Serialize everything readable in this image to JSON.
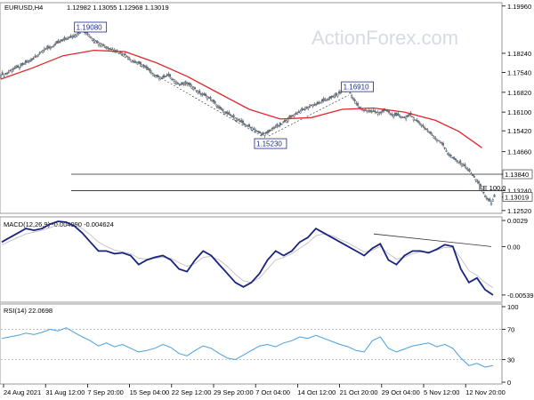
{
  "chart_data": [
    {
      "type": "candlestick",
      "symbol_header": "EURUSD,H4",
      "ohlc_header": "1.12982 1.13055 1.12968 1.13019",
      "watermark": "ActionForex.com",
      "ylim": [
        1.1245,
        1.2005
      ],
      "y_ticks": [
        "1.19960",
        "1.18240",
        "1.17540",
        "1.16820",
        "1.16100",
        "1.15420",
        "1.14660",
        "1.13840",
        "1.13240",
        "1.13019",
        "1.12520"
      ],
      "x_ticks": [
        "24 Aug 2021",
        "31 Aug 12:00",
        "7 Sep 20:00",
        "15 Sep 04:00",
        "22 Sep 12:00",
        "29 Sep 20:00",
        "7 Oct 04:00",
        "14 Oct 12:00",
        "21 Oct 20:00",
        "29 Oct 04:00",
        "5 Nov 12:00",
        "12 Nov 20:00"
      ],
      "price_close_path": [
        [
          0,
          1.1745
        ],
        [
          4,
          1.1752
        ],
        [
          8,
          1.1768
        ],
        [
          12,
          1.1775
        ],
        [
          16,
          1.179
        ],
        [
          20,
          1.18
        ],
        [
          24,
          1.182
        ],
        [
          28,
          1.184
        ],
        [
          32,
          1.1845
        ],
        [
          36,
          1.186
        ],
        [
          40,
          1.1872
        ],
        [
          44,
          1.188
        ],
        [
          48,
          1.189
        ],
        [
          52,
          1.1908
        ],
        [
          56,
          1.1895
        ],
        [
          60,
          1.187
        ],
        [
          64,
          1.186
        ],
        [
          68,
          1.1845
        ],
        [
          72,
          1.1838
        ],
        [
          76,
          1.183
        ],
        [
          80,
          1.1818
        ],
        [
          84,
          1.18
        ],
        [
          88,
          1.179
        ],
        [
          92,
          1.178
        ],
        [
          96,
          1.176
        ],
        [
          100,
          1.174
        ],
        [
          104,
          1.1735
        ],
        [
          108,
          1.1745
        ],
        [
          112,
          1.1722
        ],
        [
          116,
          1.171
        ],
        [
          120,
          1.1715
        ],
        [
          124,
          1.17
        ],
        [
          128,
          1.168
        ],
        [
          132,
          1.167
        ],
        [
          136,
          1.1655
        ],
        [
          140,
          1.163
        ],
        [
          144,
          1.161
        ],
        [
          148,
          1.1598
        ],
        [
          152,
          1.1585
        ],
        [
          156,
          1.157
        ],
        [
          160,
          1.1558
        ],
        [
          164,
          1.1545
        ],
        [
          168,
          1.153
        ],
        [
          172,
          1.1535
        ],
        [
          176,
          1.1555
        ],
        [
          180,
          1.1563
        ],
        [
          184,
          1.158
        ],
        [
          188,
          1.1598
        ],
        [
          192,
          1.161
        ],
        [
          196,
          1.1622
        ],
        [
          200,
          1.1635
        ],
        [
          204,
          1.164
        ],
        [
          208,
          1.1652
        ],
        [
          212,
          1.166
        ],
        [
          216,
          1.1672
        ],
        [
          220,
          1.1685
        ],
        [
          224,
          1.1691
        ],
        [
          228,
          1.165
        ],
        [
          232,
          1.162
        ],
        [
          236,
          1.1615
        ],
        [
          240,
          1.1612
        ],
        [
          244,
          1.1608
        ],
        [
          248,
          1.1618
        ],
        [
          252,
          1.16
        ],
        [
          256,
          1.1598
        ],
        [
          260,
          1.159
        ],
        [
          264,
          1.16
        ],
        [
          268,
          1.1578
        ],
        [
          272,
          1.156
        ],
        [
          276,
          1.1538
        ],
        [
          280,
          1.1515
        ],
        [
          284,
          1.15
        ],
        [
          288,
          1.146
        ],
        [
          292,
          1.144
        ],
        [
          296,
          1.1425
        ],
        [
          300,
          1.141
        ],
        [
          304,
          1.138
        ],
        [
          308,
          1.1352
        ],
        [
          312,
          1.1305
        ],
        [
          316,
          1.128
        ],
        [
          318,
          1.1302
        ]
      ],
      "ma_path": [
        [
          0,
          1.173
        ],
        [
          20,
          1.177
        ],
        [
          40,
          1.1815
        ],
        [
          60,
          1.1835
        ],
        [
          80,
          1.183
        ],
        [
          100,
          1.179
        ],
        [
          120,
          1.174
        ],
        [
          140,
          1.168
        ],
        [
          160,
          1.162
        ],
        [
          180,
          1.1585
        ],
        [
          200,
          1.159
        ],
        [
          220,
          1.162
        ],
        [
          240,
          1.1625
        ],
        [
          260,
          1.161
        ],
        [
          280,
          1.158
        ],
        [
          295,
          1.154
        ],
        [
          310,
          1.148
        ]
      ],
      "labels": [
        {
          "text": "1.19080",
          "at": [
            52,
            1.1908
          ]
        },
        {
          "text": "1.15230",
          "at": [
            168,
            1.1523
          ]
        },
        {
          "text": "1.16910",
          "at": [
            224,
            1.1691
          ]
        }
      ],
      "fib_tag": "FE 100.0",
      "hlines": [
        1.1384,
        1.1324
      ]
    },
    {
      "type": "line",
      "name": "MACD(12,26,9) -0.004990 -0.004624",
      "y_ticks": [
        "0.0029",
        "0.00",
        "-0.005396"
      ],
      "ylim": [
        -0.006,
        0.0031
      ],
      "series": [
        {
          "name": "macd",
          "values": [
            0.0005,
            0.001,
            0.0015,
            0.002,
            0.0018,
            0.002,
            0.0025,
            0.0028,
            0.0027,
            0.0023,
            0.0015,
            0.0005,
            -0.0005,
            -0.0005,
            -0.0008,
            -0.0007,
            -0.001,
            -0.002,
            -0.0015,
            -0.0012,
            -0.001,
            -0.0015,
            -0.0025,
            -0.0028,
            -0.0015,
            -0.0005,
            -0.001,
            -0.002,
            -0.003,
            -0.004,
            -0.0045,
            -0.004,
            -0.003,
            -0.0015,
            -0.0005,
            -0.001,
            -0.0005,
            0.0005,
            0.001,
            0.002,
            0.0015,
            0.001,
            0.0005,
            0.0,
            -0.0005,
            -0.001,
            -0.0002,
            0.0003,
            -0.0015,
            -0.002,
            -0.001,
            -0.0005,
            -0.0005,
            -0.0007,
            -0.0003,
            0.0002,
            0.0,
            -0.0025,
            -0.004,
            -0.0035,
            -0.0048,
            -0.0054
          ]
        },
        {
          "name": "signal",
          "values": [
            0.0002,
            0.0006,
            0.001,
            0.0014,
            0.0016,
            0.0018,
            0.0021,
            0.0024,
            0.0025,
            0.0024,
            0.002,
            0.0013,
            0.0005,
            0.0,
            -0.0004,
            -0.0006,
            -0.0008,
            -0.0013,
            -0.0014,
            -0.0013,
            -0.0012,
            -0.0013,
            -0.0018,
            -0.0022,
            -0.0019,
            -0.0012,
            -0.0011,
            -0.0015,
            -0.0022,
            -0.0031,
            -0.0038,
            -0.004,
            -0.0035,
            -0.0025,
            -0.0015,
            -0.0012,
            -0.0008,
            -0.0002,
            0.0004,
            0.0012,
            0.0014,
            0.0012,
            0.0008,
            0.0004,
            -0.0001,
            -0.0006,
            -0.0004,
            0.0,
            -0.0008,
            -0.0014,
            -0.0012,
            -0.0008,
            -0.0006,
            -0.0006,
            -0.0004,
            -0.0001,
            -0.0001,
            -0.0013,
            -0.0027,
            -0.0032,
            -0.004,
            -0.0046
          ]
        }
      ],
      "trendline": [
        [
          0.0014,
          0.0
        ],
        [
          0.0015,
          -0.0
        ]
      ]
    },
    {
      "type": "line",
      "name": "RSI(14) 22.0698",
      "y_ticks": [
        "100",
        "70",
        "30",
        "0"
      ],
      "ylim": [
        0,
        100
      ],
      "levels": [
        70,
        30
      ],
      "series": [
        {
          "name": "rsi",
          "values": [
            58,
            60,
            62,
            65,
            63,
            66,
            70,
            68,
            72,
            66,
            60,
            55,
            48,
            52,
            47,
            50,
            45,
            40,
            42,
            45,
            50,
            46,
            38,
            35,
            42,
            48,
            45,
            38,
            32,
            30,
            36,
            42,
            48,
            50,
            47,
            52,
            55,
            60,
            58,
            62,
            58,
            54,
            50,
            47,
            42,
            40,
            55,
            60,
            45,
            40,
            44,
            48,
            50,
            52,
            47,
            50,
            45,
            32,
            22,
            25,
            20,
            22
          ]
        }
      ]
    }
  ]
}
